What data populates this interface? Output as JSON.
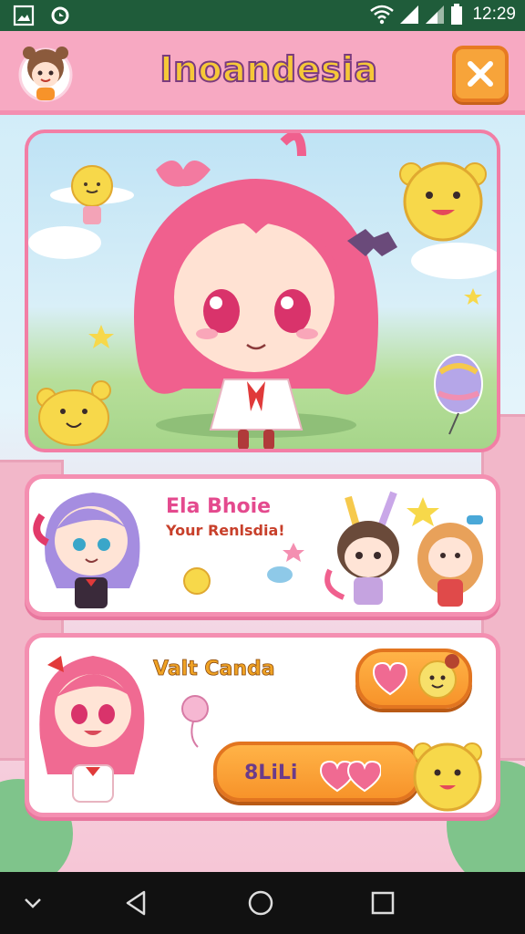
{
  "status_bar": {
    "time": "12:29",
    "left_icons": [
      "image-icon",
      "sync-icon"
    ],
    "right_icons": [
      "wifi-icon",
      "signal-icon",
      "signal-icon-2",
      "battery-icon"
    ]
  },
  "header": {
    "title": "Inoandesia",
    "avatar_icon": "chibi-avatar-icon",
    "close_icon": "close-icon"
  },
  "hero": {
    "character": "pink-haired-chibi-girl"
  },
  "card1": {
    "title": "Ela Bhoie",
    "subtitle": "Your Renlsdia!"
  },
  "card2": {
    "title": "Valt Canda",
    "button2_label": "8LiLi"
  },
  "nav": {
    "items": [
      "chevron-down-icon",
      "back-icon",
      "home-icon",
      "recents-icon"
    ]
  },
  "colors": {
    "accent_pink": "#f48fb1",
    "header_pink": "#f7a9c2",
    "orange": "#f7932a",
    "title_yellow": "#f6c838"
  }
}
